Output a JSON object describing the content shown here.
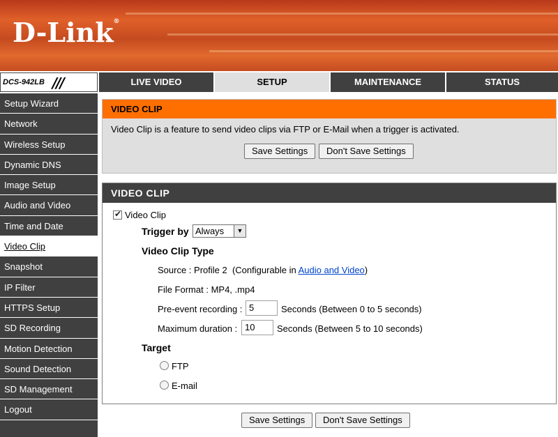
{
  "brand": {
    "logo_text": "D-Link",
    "registered": "®"
  },
  "model": {
    "name": "DCS-942LB",
    "slashes": "///"
  },
  "tabs": [
    {
      "label": "LIVE VIDEO"
    },
    {
      "label": "SETUP"
    },
    {
      "label": "MAINTENANCE"
    },
    {
      "label": "STATUS"
    }
  ],
  "active_tab": "SETUP",
  "sidebar": {
    "items": [
      {
        "label": "Setup Wizard"
      },
      {
        "label": "Network"
      },
      {
        "label": "Wireless Setup"
      },
      {
        "label": "Dynamic DNS"
      },
      {
        "label": "Image Setup"
      },
      {
        "label": "Audio and Video"
      },
      {
        "label": "Time and Date"
      },
      {
        "label": "Video Clip"
      },
      {
        "label": "Snapshot"
      },
      {
        "label": "IP Filter"
      },
      {
        "label": "HTTPS Setup"
      },
      {
        "label": "SD Recording"
      },
      {
        "label": "Motion Detection"
      },
      {
        "label": "Sound Detection"
      },
      {
        "label": "SD Management"
      },
      {
        "label": "Logout"
      }
    ],
    "active": "Video Clip"
  },
  "intro": {
    "title": "VIDEO CLIP",
    "description": "Video Clip is a feature to send video clips via FTP or E-Mail when a trigger is activated.",
    "save_label": "Save Settings",
    "dont_save_label": "Don't Save Settings"
  },
  "settings": {
    "title": "VIDEO CLIP",
    "enable_label": "Video Clip",
    "enable_checked": true,
    "trigger_label": "Trigger by",
    "trigger_value": "Always",
    "clip_type_label": "Video Clip Type",
    "source_prefix": "Source : Profile 2  (Configurable in ",
    "source_link": "Audio and Video",
    "source_suffix": ")",
    "file_format": "File Format : MP4, .mp4",
    "pre_event_label": "Pre-event recording :",
    "pre_event_value": "5",
    "pre_event_hint": "Seconds (Between 0 to 5 seconds)",
    "max_duration_label": "Maximum duration :",
    "max_duration_value": "10",
    "max_duration_hint": "Seconds (Between 5 to 10 seconds)",
    "target_label": "Target",
    "targets": [
      {
        "label": "FTP",
        "selected": false
      },
      {
        "label": "E-mail",
        "selected": false
      }
    ]
  },
  "footer": {
    "save_label": "Save Settings",
    "dont_save_label": "Don't Save Settings"
  },
  "colors": {
    "orange_bar": "#ff6f00",
    "dark_bar": "#404040",
    "panel_gray": "#dfdfdf",
    "link": "#0044cc"
  }
}
